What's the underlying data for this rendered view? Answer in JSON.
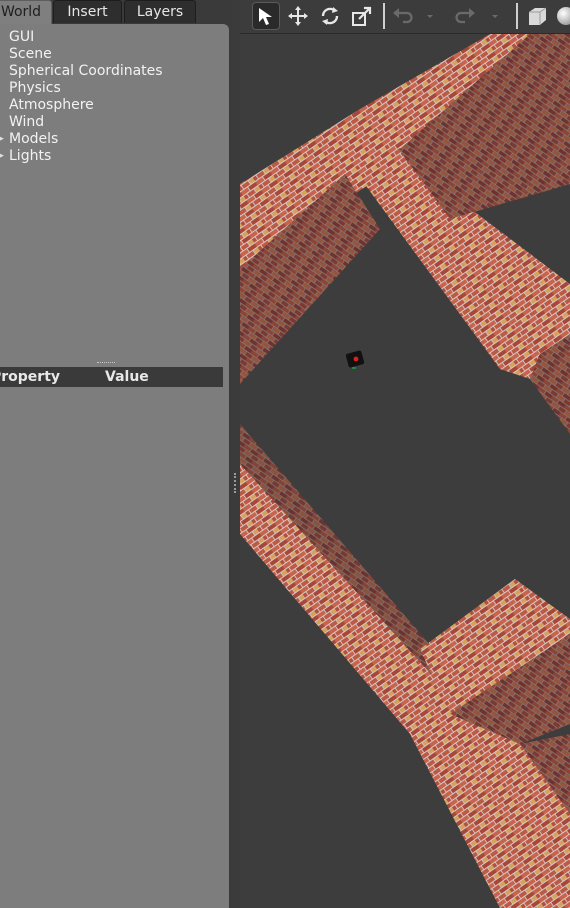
{
  "tabs": [
    {
      "label": "World",
      "active": true
    },
    {
      "label": "Insert",
      "active": false
    },
    {
      "label": "Layers",
      "active": false
    }
  ],
  "tree": [
    {
      "label": "GUI",
      "expandable": false
    },
    {
      "label": "Scene",
      "expandable": false
    },
    {
      "label": "Spherical Coordinates",
      "expandable": false
    },
    {
      "label": "Physics",
      "expandable": false
    },
    {
      "label": "Atmosphere",
      "expandable": false
    },
    {
      "label": "Wind",
      "expandable": false
    },
    {
      "label": "Models",
      "expandable": true
    },
    {
      "label": "Lights",
      "expandable": true
    }
  ],
  "properties": {
    "col_property": "Property",
    "col_value": "Value"
  },
  "toolbar": {
    "icons": [
      "select-arrow-icon",
      "translate-icon",
      "rotate-icon",
      "scale-icon",
      "undo-icon",
      "undo-dropdown-icon",
      "redo-icon",
      "redo-dropdown-icon",
      "box-shape-icon",
      "sphere-shape-icon"
    ]
  },
  "colors": {
    "panel_bg": "#7d7d7d",
    "toolbar_bg": "#3c3c3c",
    "viewport_floor": "#3d3d3d",
    "brick": "#b0523f"
  }
}
